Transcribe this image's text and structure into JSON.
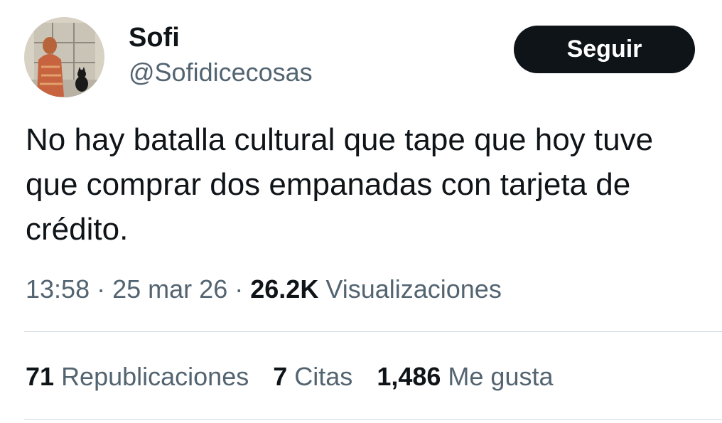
{
  "author": {
    "display_name": "Sofi",
    "handle": "@Sofidicecosas",
    "avatar_icon": "profile-photo-cat-window"
  },
  "follow_button": {
    "label": "Seguir"
  },
  "tweet": {
    "text": "No hay batalla cultural que tape que hoy tuve que comprar dos empanadas con tarjeta de crédito."
  },
  "meta": {
    "time": "13:58",
    "separator": "·",
    "date": "25 mar 26",
    "views_count": "26.2K",
    "views_label": "Visualizaciones"
  },
  "stats": {
    "reposts_count": "71",
    "reposts_label": "Republicaciones",
    "quotes_count": "7",
    "quotes_label": "Citas",
    "likes_count": "1,486",
    "likes_label": "Me gusta"
  },
  "colors": {
    "text_primary": "#0f1419",
    "text_secondary": "#536471",
    "button_bg": "#0f1419",
    "divider": "#cfd9de"
  }
}
